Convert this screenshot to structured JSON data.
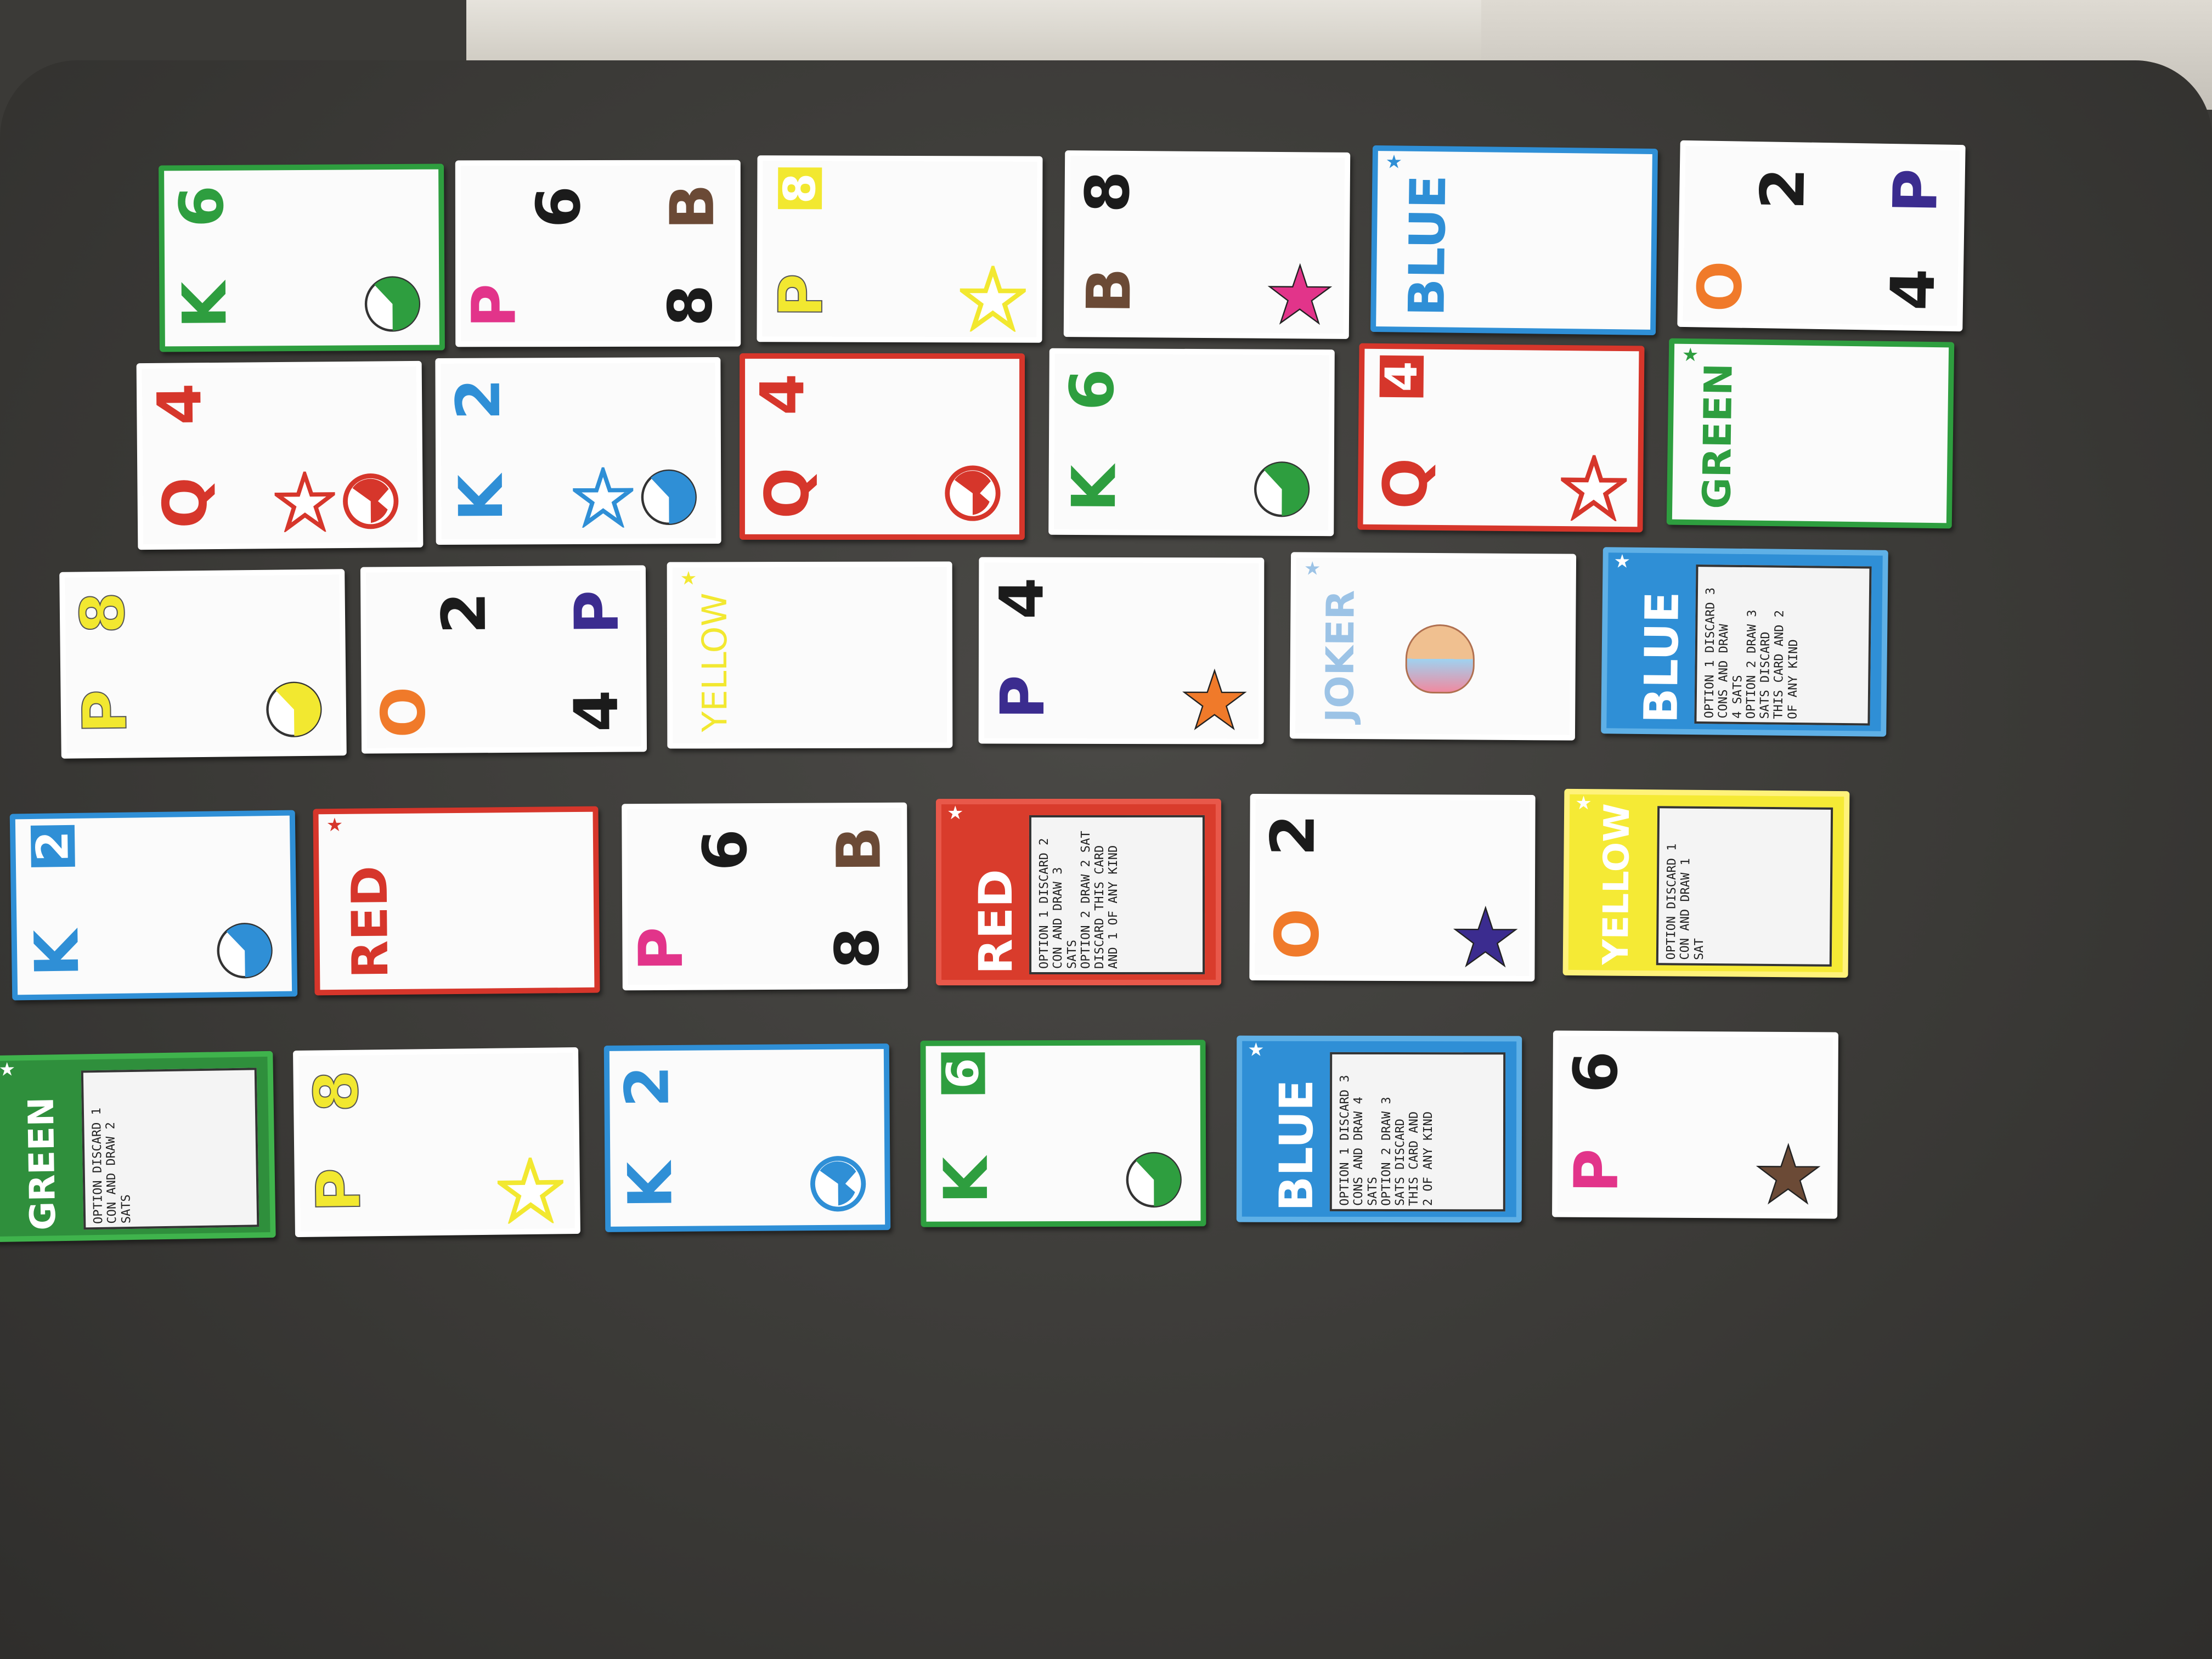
{
  "colors": {
    "green": "#2e9e3f",
    "blue": "#2f8fd6",
    "yellow": "#f2e830",
    "red": "#d6362b",
    "black": "#1b1b1b",
    "pink": "#e2348a",
    "purple": "#3b2c8f",
    "brown": "#6b4a36",
    "orange": "#f07a2a"
  },
  "cards": [
    {
      "row": 1,
      "col": 1,
      "type": "letter",
      "border": "green",
      "glyphs": [
        {
          "t": "6",
          "c": "green"
        },
        {
          "t": "K",
          "c": "green"
        }
      ],
      "symbol": "half-circle-icon",
      "symbol_color": "green"
    },
    {
      "row": 1,
      "col": 2,
      "type": "letter",
      "border": "white",
      "glyphs": [
        {
          "t": "6",
          "c": "black"
        },
        {
          "t": "P",
          "c": "pink"
        },
        {
          "t": "B",
          "c": "brown"
        },
        {
          "t": "8",
          "c": "black"
        }
      ],
      "symbol": "",
      "symbol_color": ""
    },
    {
      "row": 1,
      "col": 3,
      "type": "letter",
      "border": "white",
      "glyphs": [
        {
          "t": "8",
          "c": "yellow-box"
        },
        {
          "t": "P",
          "c": "yellow"
        }
      ],
      "symbol": "star-icon",
      "symbol_color": "yellow-outline"
    },
    {
      "row": 1,
      "col": 4,
      "type": "letter",
      "border": "white",
      "glyphs": [
        {
          "t": "8",
          "c": "black"
        },
        {
          "t": "B",
          "c": "brown"
        }
      ],
      "symbol": "star-icon",
      "symbol_color": "pink"
    },
    {
      "row": 1,
      "col": 5,
      "type": "word",
      "border": "blue",
      "word": "BLUE",
      "word_color": "blue"
    },
    {
      "row": 1,
      "col": 6,
      "type": "letter",
      "border": "white",
      "glyphs": [
        {
          "t": "2",
          "c": "black"
        },
        {
          "t": "O",
          "c": "orange"
        },
        {
          "t": "P",
          "c": "purple"
        },
        {
          "t": "4",
          "c": "black"
        }
      ],
      "symbol": "",
      "symbol_color": ""
    },
    {
      "row": 2,
      "col": 1,
      "type": "letter",
      "border": "white",
      "glyphs": [
        {
          "t": "4",
          "c": "red"
        },
        {
          "t": "Q",
          "c": "red"
        }
      ],
      "symbol": "pacman-circle-icon",
      "symbol_color": "red",
      "extra": "star-icon"
    },
    {
      "row": 2,
      "col": 2,
      "type": "letter",
      "border": "white",
      "glyphs": [
        {
          "t": "2",
          "c": "blue"
        },
        {
          "t": "K",
          "c": "blue"
        }
      ],
      "symbol": "half-circle-icon",
      "symbol_color": "blue",
      "extra": "star-icon"
    },
    {
      "row": 2,
      "col": 3,
      "type": "letter",
      "border": "red",
      "glyphs": [
        {
          "t": "4",
          "c": "red"
        },
        {
          "t": "Q",
          "c": "red"
        }
      ],
      "symbol": "pacman-circle-icon",
      "symbol_color": "red"
    },
    {
      "row": 2,
      "col": 4,
      "type": "letter",
      "border": "white",
      "glyphs": [
        {
          "t": "6",
          "c": "green"
        },
        {
          "t": "K",
          "c": "green"
        }
      ],
      "symbol": "half-circle-icon",
      "symbol_color": "green"
    },
    {
      "row": 2,
      "col": 5,
      "type": "letter",
      "border": "red",
      "glyphs": [
        {
          "t": "4",
          "c": "red-box"
        },
        {
          "t": "Q",
          "c": "red"
        }
      ],
      "symbol": "star-icon",
      "symbol_color": "red-outline"
    },
    {
      "row": 2,
      "col": 6,
      "type": "word",
      "border": "green",
      "word": "GREEN",
      "word_color": "green"
    },
    {
      "row": 3,
      "col": 1,
      "type": "letter",
      "border": "white",
      "glyphs": [
        {
          "t": "8",
          "c": "yellow"
        },
        {
          "t": "P",
          "c": "yellow"
        }
      ],
      "symbol": "half-circle-icon",
      "symbol_color": "yellow"
    },
    {
      "row": 3,
      "col": 2,
      "type": "letter",
      "border": "white",
      "glyphs": [
        {
          "t": "2",
          "c": "black"
        },
        {
          "t": "O",
          "c": "orange"
        },
        {
          "t": "P",
          "c": "purple"
        },
        {
          "t": "4",
          "c": "black"
        }
      ],
      "symbol": "",
      "symbol_color": ""
    },
    {
      "row": 3,
      "col": 3,
      "type": "word",
      "border": "white",
      "word": "YELLOW",
      "word_color": "yellow"
    },
    {
      "row": 3,
      "col": 4,
      "type": "letter",
      "border": "white",
      "glyphs": [
        {
          "t": "4",
          "c": "black"
        },
        {
          "t": "P",
          "c": "purple"
        }
      ],
      "symbol": "star-icon",
      "symbol_color": "orange"
    },
    {
      "row": 3,
      "col": 5,
      "type": "word",
      "border": "white",
      "word": "JOKER",
      "word_color": "lightblue",
      "extra": "joker-face-icon"
    },
    {
      "row": 3,
      "col": 6,
      "type": "action",
      "fill": "blue",
      "word": "BLUE",
      "lines": [
        "OPTION 1 DISCARD 3",
        "CONS AND DRAW",
        "4 SATS",
        "OPTION 2 DRAW 3",
        "SATS DISCARD",
        "THIS CARD AND 2",
        "OF ANY KIND"
      ]
    },
    {
      "row": 4,
      "col": 1,
      "type": "letter",
      "border": "blue",
      "glyphs": [
        {
          "t": "2",
          "c": "blue-box"
        },
        {
          "t": "K",
          "c": "blue"
        }
      ],
      "symbol": "half-circle-icon",
      "symbol_color": "blue"
    },
    {
      "row": 4,
      "col": 2,
      "type": "word",
      "border": "red",
      "word": "RED",
      "word_color": "red"
    },
    {
      "row": 4,
      "col": 3,
      "type": "letter",
      "border": "white",
      "glyphs": [
        {
          "t": "6",
          "c": "black"
        },
        {
          "t": "P",
          "c": "pink"
        },
        {
          "t": "B",
          "c": "brown"
        },
        {
          "t": "8",
          "c": "black"
        }
      ],
      "symbol": "",
      "symbol_color": ""
    },
    {
      "row": 4,
      "col": 4,
      "type": "action",
      "fill": "red",
      "word": "RED",
      "lines": [
        "OPTION 1 DISCARD 2",
        "CON AND DRAW 3",
        "SATS",
        "OPTION 2 DRAW 2 SAT",
        "DISCARD THIS CARD",
        "AND 1 OF ANY KIND"
      ]
    },
    {
      "row": 4,
      "col": 5,
      "type": "letter",
      "border": "white",
      "glyphs": [
        {
          "t": "2",
          "c": "black"
        },
        {
          "t": "O",
          "c": "orange"
        }
      ],
      "symbol": "star-icon",
      "symbol_color": "purple"
    },
    {
      "row": 4,
      "col": 6,
      "type": "action",
      "fill": "yellow",
      "word": "YELLOW",
      "lines": [
        "OPTION DISCARD 1",
        "CON AND DRAW 1",
        "SAT"
      ]
    },
    {
      "row": 5,
      "col": 1,
      "type": "action",
      "fill": "green",
      "word": "GREEN",
      "lines": [
        "OPTION DISCARD 1",
        "CON AND DRAW 2",
        "SATS"
      ]
    },
    {
      "row": 5,
      "col": 2,
      "type": "letter",
      "border": "white",
      "glyphs": [
        {
          "t": "8",
          "c": "yellow"
        },
        {
          "t": "P",
          "c": "yellow"
        }
      ],
      "symbol": "star-icon",
      "symbol_color": "yellow-outline"
    },
    {
      "row": 5,
      "col": 3,
      "type": "letter",
      "border": "blue",
      "glyphs": [
        {
          "t": "2",
          "c": "blue"
        },
        {
          "t": "K",
          "c": "blue"
        }
      ],
      "symbol": "pacman-circle-icon",
      "symbol_color": "blue"
    },
    {
      "row": 5,
      "col": 4,
      "type": "letter",
      "border": "green",
      "glyphs": [
        {
          "t": "6",
          "c": "green-box"
        },
        {
          "t": "K",
          "c": "green"
        }
      ],
      "symbol": "half-circle-icon",
      "symbol_color": "green"
    },
    {
      "row": 5,
      "col": 5,
      "type": "action",
      "fill": "blue",
      "word": "BLUE",
      "lines": [
        "OPTION 1 DISCARD 3",
        "CONS AND DRAW 4",
        "SATS",
        "OPTION 2 DRAW 3",
        "SATS DISCARD",
        "THIS CARD AND",
        "2 OF ANY KIND"
      ]
    },
    {
      "row": 5,
      "col": 6,
      "type": "letter",
      "border": "white",
      "glyphs": [
        {
          "t": "6",
          "c": "black"
        },
        {
          "t": "P",
          "c": "pink"
        }
      ],
      "symbol": "star-icon",
      "symbol_color": "brown"
    }
  ]
}
